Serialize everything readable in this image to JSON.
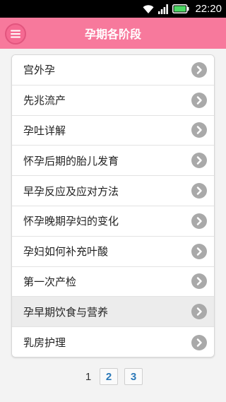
{
  "status_bar": {
    "time": "22:20",
    "icons": [
      "wifi-icon",
      "signal-icon",
      "battery-icon"
    ]
  },
  "app_bar": {
    "title": "孕期各阶段",
    "menu_icon": "menu-icon",
    "color": "#f7799c"
  },
  "list": {
    "items": [
      {
        "label": "宫外孕"
      },
      {
        "label": "先兆流产"
      },
      {
        "label": "孕吐详解"
      },
      {
        "label": "怀孕后期的胎儿发育"
      },
      {
        "label": "早孕反应及应对方法"
      },
      {
        "label": "怀孕晚期孕妇的变化"
      },
      {
        "label": "孕妇如何补充叶酸"
      },
      {
        "label": "第一次产检"
      },
      {
        "label": "孕早期饮食与营养",
        "highlighted": true
      },
      {
        "label": "乳房护理"
      }
    ],
    "chevron_icon": "chevron-right-icon"
  },
  "pagination": {
    "current": "1",
    "pages": [
      "2",
      "3"
    ],
    "link_color": "#2a78b8"
  }
}
